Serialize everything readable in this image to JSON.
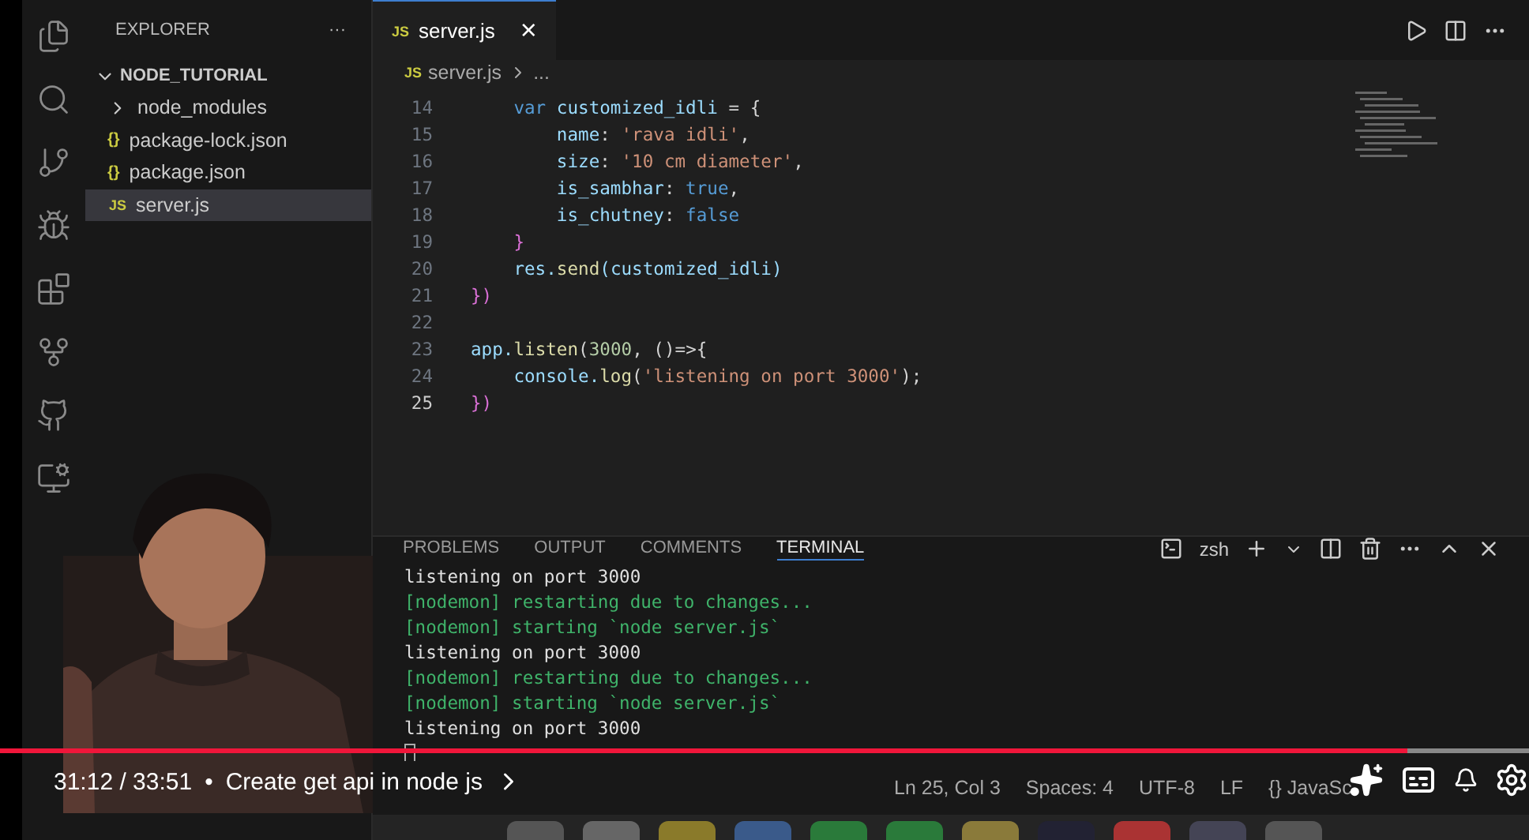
{
  "sidebar": {
    "title": "EXPLORER",
    "more": "···",
    "project": {
      "name": "NODE_TUTORIAL",
      "expanded": true
    },
    "items": [
      {
        "name": "node_modules",
        "kind": "folder",
        "selected": false
      },
      {
        "name": "package-lock.json",
        "kind": "json",
        "icon": "{}",
        "selected": false
      },
      {
        "name": "package.json",
        "kind": "json",
        "icon": "{}",
        "selected": false
      },
      {
        "name": "server.js",
        "kind": "js",
        "icon": "JS",
        "selected": true
      }
    ]
  },
  "editor": {
    "tab": {
      "label": "server.js",
      "badge": "JS",
      "close": "×"
    },
    "breadcrumb": {
      "badge": "JS",
      "file": "server.js",
      "rest": "..."
    },
    "lines": [
      {
        "n": "14",
        "tokens": [
          {
            "t": "    var ",
            "color": "#569cd6"
          },
          {
            "t": "customized_idli",
            "color": "#9cdcfe"
          },
          {
            "t": " = {",
            "color": "#d4d4d4"
          }
        ]
      },
      {
        "n": "15",
        "tokens": [
          {
            "t": "        name",
            "color": "#9cdcfe"
          },
          {
            "t": ": ",
            "color": "#d4d4d4"
          },
          {
            "t": "'rava idli'",
            "color": "#ce9178"
          },
          {
            "t": ",",
            "color": "#d4d4d4"
          }
        ]
      },
      {
        "n": "16",
        "tokens": [
          {
            "t": "        size",
            "color": "#9cdcfe"
          },
          {
            "t": ": ",
            "color": "#d4d4d4"
          },
          {
            "t": "'10 cm diameter'",
            "color": "#ce9178"
          },
          {
            "t": ",",
            "color": "#d4d4d4"
          }
        ]
      },
      {
        "n": "17",
        "tokens": [
          {
            "t": "        is_sambhar",
            "color": "#9cdcfe"
          },
          {
            "t": ": ",
            "color": "#d4d4d4"
          },
          {
            "t": "true",
            "color": "#569cd6"
          },
          {
            "t": ",",
            "color": "#d4d4d4"
          }
        ]
      },
      {
        "n": "18",
        "tokens": [
          {
            "t": "        is_chutney",
            "color": "#9cdcfe"
          },
          {
            "t": ": ",
            "color": "#d4d4d4"
          },
          {
            "t": "false",
            "color": "#569cd6"
          }
        ]
      },
      {
        "n": "19",
        "tokens": [
          {
            "t": "    }",
            "color": "#da70d6"
          }
        ]
      },
      {
        "n": "20",
        "tokens": [
          {
            "t": "    res.",
            "color": "#9cdcfe"
          },
          {
            "t": "send",
            "color": "#dcdcaa"
          },
          {
            "t": "(customized_idli)",
            "color": "#9cdcfe"
          }
        ]
      },
      {
        "n": "21",
        "tokens": [
          {
            "t": "})",
            "color": "#da70d6"
          }
        ]
      },
      {
        "n": "22"
      },
      {
        "n": "23",
        "tokens": [
          {
            "t": "app.",
            "color": "#9cdcfe"
          },
          {
            "t": "listen",
            "color": "#dcdcaa"
          },
          {
            "t": "(",
            "color": "#d4d4d4"
          },
          {
            "t": "3000",
            "color": "#b5cea8"
          },
          {
            "t": ", ()=>{",
            "color": "#d4d4d4"
          }
        ]
      },
      {
        "n": "24",
        "tokens": [
          {
            "t": "    console.",
            "color": "#9cdcfe"
          },
          {
            "t": "log",
            "color": "#dcdcaa"
          },
          {
            "t": "(",
            "color": "#d4d4d4"
          },
          {
            "t": "'listening on port 3000'",
            "color": "#ce9178"
          },
          {
            "t": ");",
            "color": "#d4d4d4"
          }
        ]
      },
      {
        "n": "25",
        "tokens": [
          {
            "t": "})",
            "color": "#da70d6"
          }
        ]
      }
    ]
  },
  "panel": {
    "tabs": [
      {
        "label": "PROBLEMS",
        "selected": false
      },
      {
        "label": "OUTPUT",
        "selected": false
      },
      {
        "label": "COMMENTS",
        "selected": false
      },
      {
        "label": "TERMINAL",
        "selected": true
      }
    ],
    "shell": "zsh",
    "terminal": [
      {
        "text": "listening on port 3000",
        "kind": "plain"
      },
      {
        "text": "[nodemon] restarting due to changes...",
        "kind": "nodemon"
      },
      {
        "text": "[nodemon] starting `node server.js`",
        "kind": "nodemon"
      },
      {
        "text": "listening on port 3000",
        "kind": "plain"
      },
      {
        "text": "[nodemon] restarting due to changes...",
        "kind": "nodemon"
      },
      {
        "text": "[nodemon] starting `node server.js`",
        "kind": "nodemon"
      },
      {
        "text": "listening on port 3000",
        "kind": "plain"
      }
    ]
  },
  "status_bar": [
    "Ln 25, Col 3",
    "Spaces: 4",
    "UTF-8",
    "LF"
  ],
  "language": {
    "braces": "{}",
    "name": "JavaSc"
  },
  "player": {
    "level": 0.92,
    "time": "31:12 / 33:51",
    "separator": "•",
    "title": "Create get api in node js"
  }
}
